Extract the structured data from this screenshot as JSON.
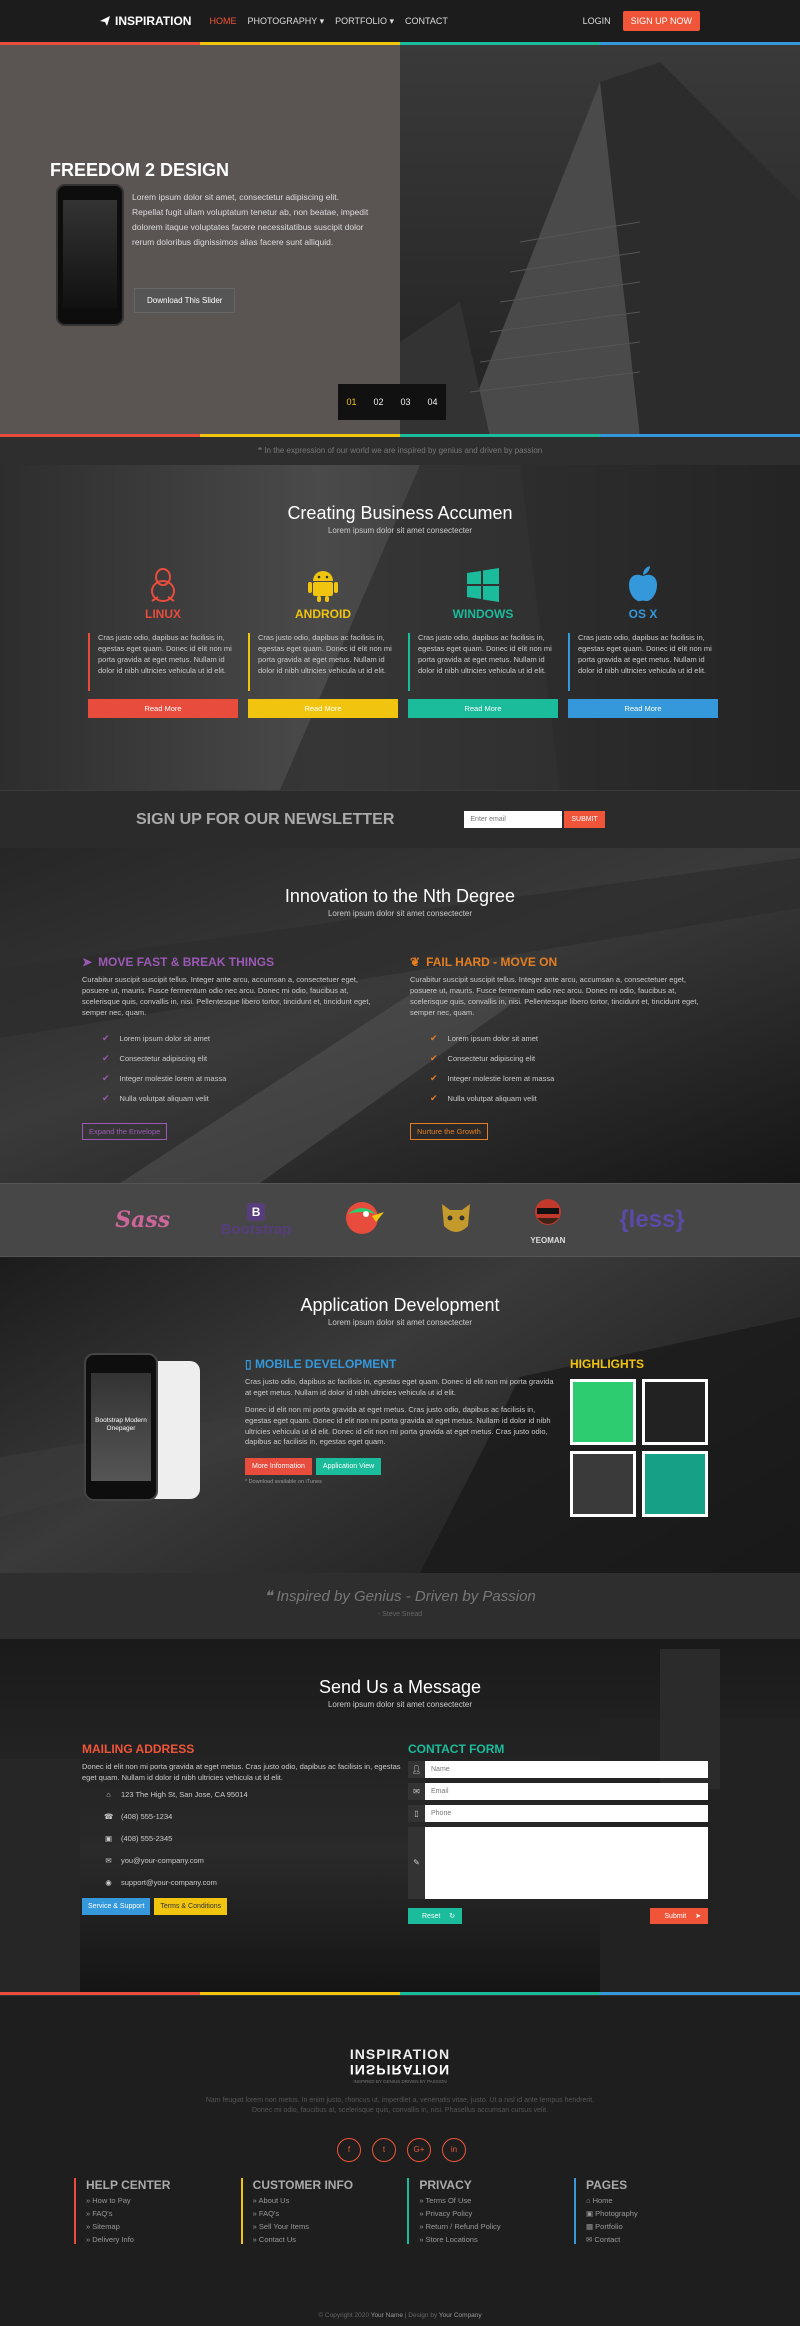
{
  "nav": {
    "brand": "INSPIRATION",
    "items": [
      "HOME",
      "PHOTOGRAPHY",
      "PORTFOLIO",
      "CONTACT"
    ],
    "login": "LOGIN",
    "signup": "SIGN UP NOW"
  },
  "hero": {
    "title": "FREEDOM 2 DESIGN",
    "text": "Lorem ipsum dolor sit amet, consectetur adipiscing elit. Repellat fugit ullam voluptatum tenetur ab, non beatae, impedit dolorem itaque voluptates facere necessitatibus suscipit dolor rerum doloribus dignissimos alias facere sunt alliquid.",
    "button": "Download This Slider",
    "slides": [
      "01",
      "02",
      "03",
      "04"
    ]
  },
  "quote_strip": "In the expression of our world we are inspired by genius and driven by passion",
  "platforms": {
    "title": "Creating Business Accumen",
    "subtitle": "Lorem ipsum dolor sit amet consectecter",
    "text": "Cras justo odio, dapibus ac facilisis in, egestas eget quam. Donec id elit non mi porta gravida at eget metus. Nullam id dolor id nibh ultricies vehicula ut id elit.",
    "read_more": "Read More",
    "items": [
      {
        "name": "LINUX",
        "color": "#e74c3c"
      },
      {
        "name": "ANDROID",
        "color": "#f1c40f"
      },
      {
        "name": "WINDOWS",
        "color": "#1abc9c"
      },
      {
        "name": "OS X",
        "color": "#3498db"
      }
    ]
  },
  "newsletter": {
    "title": "SIGN UP FOR OUR NEWSLETTER",
    "placeholder": "Enter email",
    "button": "SUBMIT"
  },
  "innovation": {
    "title": "Innovation to the Nth Degree",
    "subtitle": "Lorem ipsum dolor sit amet consectecter",
    "text": "Curabitur suscipit suscipit tellus. Integer ante arcu, accumsan a, consectetuer eget, posuere ut, mauris. Fusce fermentum odio nec arcu. Donec mi odio, faucibus at, scelerisque quis, convallis in, nisi. Pellentesque libero tortor, tincidunt et, tincidunt eget, semper nec, quam.",
    "list": [
      "Lorem ipsum dolor sit amet",
      "Consectetur adipiscing elit",
      "Integer molestie lorem at massa",
      "Nulla volutpat aliquam velit"
    ],
    "left": {
      "title": "MOVE FAST & BREAK THINGS",
      "button": "Expand the Envelope",
      "color": "#9b59b6"
    },
    "right": {
      "title": "FAIL HARD - MOVE ON",
      "button": "Nurture the Growth",
      "color": "#e67e22"
    }
  },
  "logos": [
    "Sass",
    "Bootstrap",
    "",
    "",
    "YEOMAN",
    "{less}"
  ],
  "appdev": {
    "title": "Application Development",
    "subtitle": "Lorem ipsum dolor sit amet consectecter",
    "screen": "Bootstrap Modern Onepager",
    "heading": "MOBILE DEVELOPMENT",
    "p1": "Cras justo odio, dapibus ac facilisis in, egestas eget quam. Donec id elit non mi porta gravida at eget metus. Nullam id dolor id nibh ultricies vehicula ut id elit.",
    "p2": "Donec id elit non mi porta gravida at eget metus. Cras justo odio, dapibus ac facilisis in, egestas eget quam. Donec id elit non mi porta gravida at eget metus. Nullam id dolor id nibh ultricies vehicula ut id elit. Donec id elit non mi porta gravida at eget metus. Cras justo odio, dapibus ac facilisis in, egestas eget quam.",
    "btn_more": "More Information",
    "btn_app": "Application View",
    "note": "* Download available on iTunes",
    "highlights": "HIGHLIGHTS"
  },
  "quote": {
    "text": "Inspired by Genius - Driven by Passion",
    "author": "- Steve Snead"
  },
  "contact": {
    "title": "Send Us a Message",
    "subtitle": "Lorem ipsum dolor sit amet consectecter",
    "mail_title": "MAILING ADDRESS",
    "mail_text": "Donec id elit non mi porta gravida at eget metus. Cras justo odio, dapibus ac facilisis in, egestas eget quam. Nullam id dolor id nibh ultricies vehicula ut id elit.",
    "address": "123 The High St, San Jose, CA 95014",
    "phone1": "(408) 555-1234",
    "phone2": "(408) 555-2345",
    "email1": "you@your-company.com",
    "email2": "support@your-company.com",
    "btn_service": "Service & Support",
    "btn_terms": "Terms & Conditions",
    "form_title": "CONTACT FORM",
    "name_ph": "Name",
    "email_ph": "Email",
    "phone_ph": "Phone",
    "reset": "Reset",
    "submit": "Submit"
  },
  "footer": {
    "brand": "INSPIRATION",
    "tagline": "INSPIRED BY GENIUS DRIVEN BY PASSION",
    "about": "Nam feugiat lorem non metus. In enim justo, rhoncus ut, imperdiet a, venenatis vitae, justo. Ut a nisl id ante tempus hendrerit. Donec mi odio, faucibus at, scelerisque quis, convallis in, nisi. Phasellus accumsan cursus velit.",
    "social": [
      "f",
      "t",
      "G+",
      "in"
    ],
    "columns": [
      {
        "title": "HELP CENTER",
        "color": "#e74c3c",
        "items": [
          "How to Pay",
          "FAQ's",
          "Sitemap",
          "Delivery Info"
        ]
      },
      {
        "title": "CUSTOMER INFO",
        "color": "#f1c40f",
        "items": [
          "About Us",
          "FAQ's",
          "Sell Your Items",
          "Contact Us"
        ]
      },
      {
        "title": "PRIVACY",
        "color": "#1abc9c",
        "items": [
          "Terms Of Use",
          "Privacy Policy",
          "Return / Refund Policy",
          "Store Locations"
        ]
      },
      {
        "title": "PAGES",
        "color": "#3498db",
        "items": [
          "Home",
          "Photography",
          "Portfolio",
          "Contact"
        ]
      }
    ],
    "copyright": "© Copyright 2020",
    "your_name": "Your Name",
    "design_by": "Design by",
    "company": "Your Company"
  }
}
